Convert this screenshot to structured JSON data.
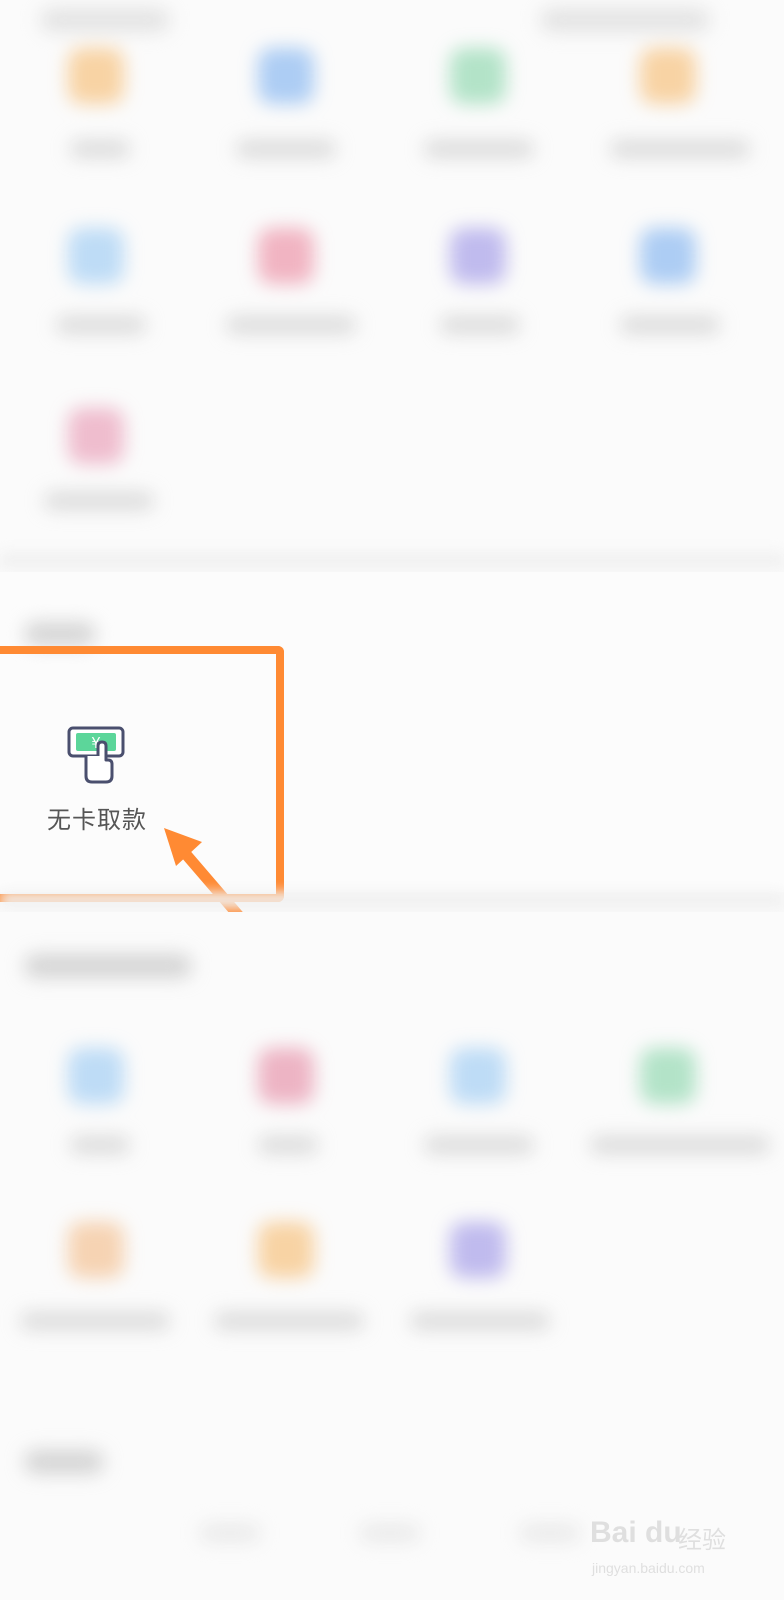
{
  "focus_item": {
    "label": "无卡取款",
    "icon": "cardless-withdrawal-icon",
    "accent": "#5cd69a"
  },
  "highlight": {
    "color": "#ff8a33"
  },
  "watermark": {
    "logo_text": "Bai du",
    "cn_text": "经验",
    "url_text": "jingyan.baidu.com"
  }
}
